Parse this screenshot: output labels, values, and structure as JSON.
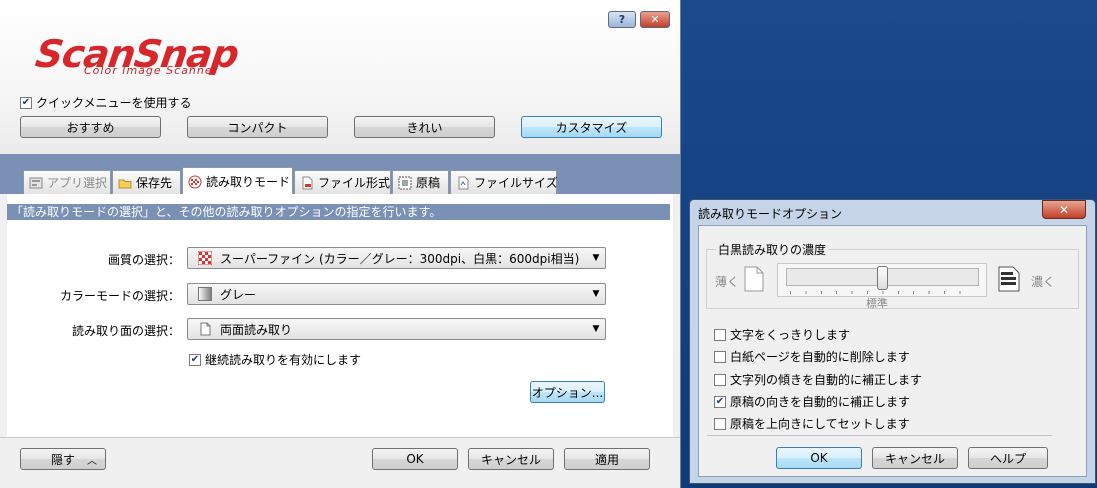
{
  "main_window": {
    "help_label": "?",
    "close_label": "✕",
    "logo_text": "ScanSnap",
    "logo_sub": "Color Image Scanner",
    "quick_menu": {
      "label": "クイックメニューを使用する",
      "checked": true
    },
    "presets": [
      "おすすめ",
      "コンパクト",
      "きれい",
      "カスタマイズ"
    ],
    "selected_preset": "カスタマイズ",
    "tabs": [
      {
        "label": "アプリ選択",
        "icon": "app-icon",
        "disabled": true
      },
      {
        "label": "保存先",
        "icon": "folder-icon"
      },
      {
        "label": "読み取りモード",
        "icon": "scan-mode-icon",
        "active": true
      },
      {
        "label": "ファイル形式",
        "icon": "file-icon"
      },
      {
        "label": "原稿",
        "icon": "document-icon"
      },
      {
        "label": "ファイルサイズ",
        "icon": "file-size-icon"
      }
    ],
    "description": "「読み取りモードの選択」と、その他の読み取りオプションの指定を行います。",
    "fields": {
      "quality_label": "画質の選択：",
      "quality_value": "スーパーファイン (カラー／グレー：300dpi、白黒：600dpi相当)",
      "color_label": "カラーモードの選択：",
      "color_value": "グレー",
      "side_label": "読み取り面の選択：",
      "side_value": "両面読み取り"
    },
    "continuous": {
      "label": "継続読み取りを有効にします",
      "checked": true
    },
    "options_button": "オプション...",
    "hide_button": "隠す",
    "ok_button": "OK",
    "cancel_button": "キャンセル",
    "apply_button": "適用"
  },
  "options_dialog": {
    "title": "読み取りモードオプション",
    "close_label": "✕",
    "density_group": "白黒読み取りの濃度",
    "light_label": "薄く",
    "dark_label": "濃く",
    "standard_label": "標準",
    "density_level": 0.5,
    "checkboxes": [
      {
        "label": "文字をくっきりします",
        "checked": false
      },
      {
        "label": "白紙ページを自動的に削除します",
        "checked": false
      },
      {
        "label": "文字列の傾きを自動的に補正します",
        "checked": false
      },
      {
        "label": "原稿の向きを自動的に補正します",
        "checked": true
      },
      {
        "label": "原稿を上向きにしてセットします",
        "checked": false
      }
    ],
    "ok_button": "OK",
    "cancel_button": "キャンセル",
    "help_button": "ヘルプ"
  },
  "colors": {
    "accent": "#7a90b4",
    "logo": "#d7272b",
    "desktop": "#0e3a78"
  }
}
